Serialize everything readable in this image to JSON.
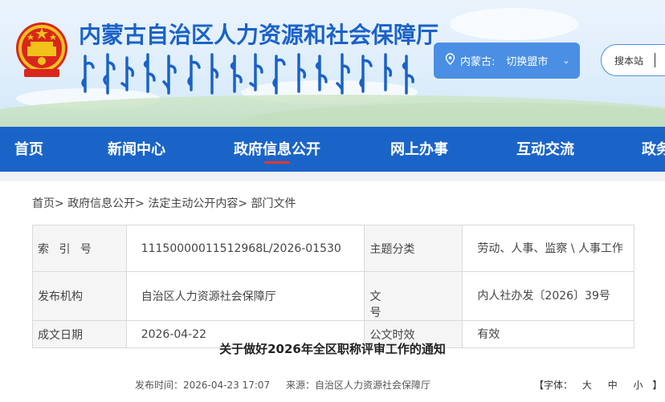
{
  "header": {
    "site_title": "内蒙古自治区人力资源和社会保障厅",
    "region_label": "内蒙古:",
    "region_switch": "切换盟市",
    "search_label": "搜本站"
  },
  "nav": {
    "items": [
      {
        "label": "首页"
      },
      {
        "label": "新闻中心"
      },
      {
        "label": "政府信息公开"
      },
      {
        "label": "网上办事"
      },
      {
        "label": "互动交流"
      },
      {
        "label": "政务"
      }
    ],
    "active_index": 2
  },
  "breadcrumb": [
    "首页>",
    "政府信息公开>",
    "法定主动公开内容>",
    "部门文件"
  ],
  "meta": {
    "index_label": "索 引 号",
    "index_value": "11150000011512968L/2026-01530",
    "topic_label": "主题分类",
    "topic_value": "劳动、人事、监察 \\ 人事工作",
    "org_label": "发布机构",
    "org_value": "自治区人力资源社会保障厅",
    "doc_label_a": "文",
    "doc_label_b": "号",
    "doc_value": "内人社办发〔2026〕39号",
    "date_label": "成文日期",
    "date_value": "2026-04-22",
    "valid_label": "公文时效",
    "valid_value": "有效"
  },
  "article": {
    "title": "关于做好2026年全区职称评审工作的通知",
    "publish_time": "发布时间：2026-04-23 17:07",
    "source": "来源：自治区人力资源社会保障厅"
  },
  "font_size": {
    "label": "【字体：",
    "large": "大",
    "medium": "中",
    "small": "小",
    "close": "】"
  },
  "colors": {
    "brand_blue": "#1b64c7",
    "title_blue": "#1a62c8",
    "accent_red": "#e8372c"
  }
}
